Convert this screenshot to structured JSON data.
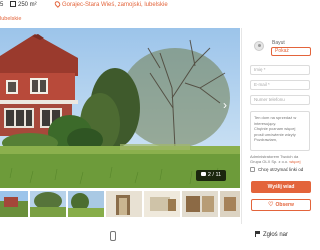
{
  "header": {
    "fragment": "5",
    "area": "250 m²",
    "location": "Gorajec-Stara Wieś, zamojski, lubelskie",
    "breadcrumb": "lubelskie"
  },
  "gallery": {
    "counter": "2 / 11",
    "next_icon": "chevron-right-icon",
    "camera_icon": "camera-icon"
  },
  "contact": {
    "name": "Bayut",
    "show_phone_button": "Pokaż",
    "fields": [
      {
        "placeholder": "Imię *"
      },
      {
        "placeholder": "E-mail *"
      },
      {
        "placeholder": "Numer telefonu"
      }
    ],
    "message_lines": [
      "Ten dom na sprzedaż w",
      "interesujący.",
      "Chętnie poznam więcej",
      "prosił umówienie wizyty",
      "",
      "Pozdrawiam,"
    ],
    "admin_line1": "Administratorem Twoich da",
    "admin_line2": "Grupa OLX Sp. z o.o.",
    "admin_link": "więcej",
    "newsletter_label": "Chcę otrzymać linki od",
    "send_button": "Wyślij wiad",
    "fav_button": "Obserw"
  },
  "footer": {
    "report_label": "Zgłoś nar"
  }
}
